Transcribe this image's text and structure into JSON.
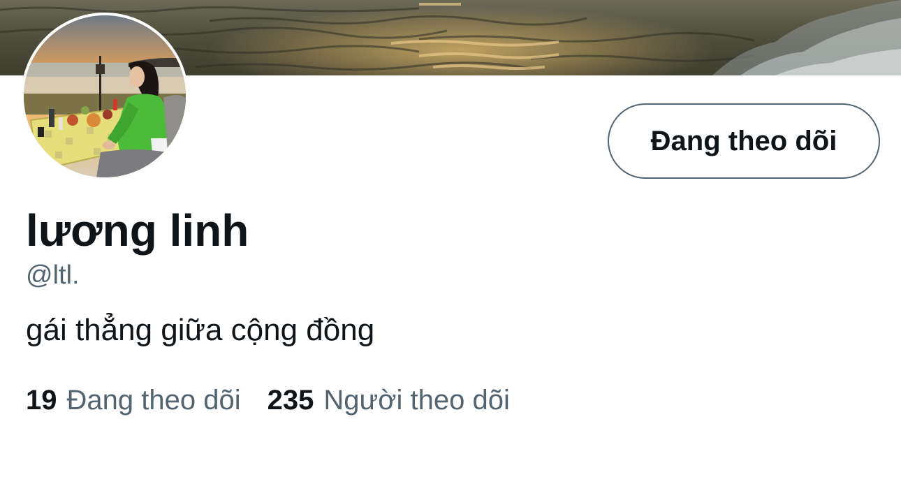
{
  "profile": {
    "display_name": "lương linh",
    "handle": "@ltl.",
    "bio": "gái thẳng giữa cộng đồng"
  },
  "follow_button": {
    "label": "Đang theo dõi"
  },
  "stats": {
    "following_count": "19",
    "following_label": "Đang theo dõi",
    "followers_count": "235",
    "followers_label": "Người theo dõi"
  },
  "icons": {
    "banner": "sunset-sea-banner-image",
    "avatar": "profile-photo-woman-green-jacket-beach-picnic"
  },
  "colors": {
    "text_primary": "#0f1419",
    "text_secondary": "#536471",
    "button_border": "#536471",
    "background": "#ffffff"
  }
}
